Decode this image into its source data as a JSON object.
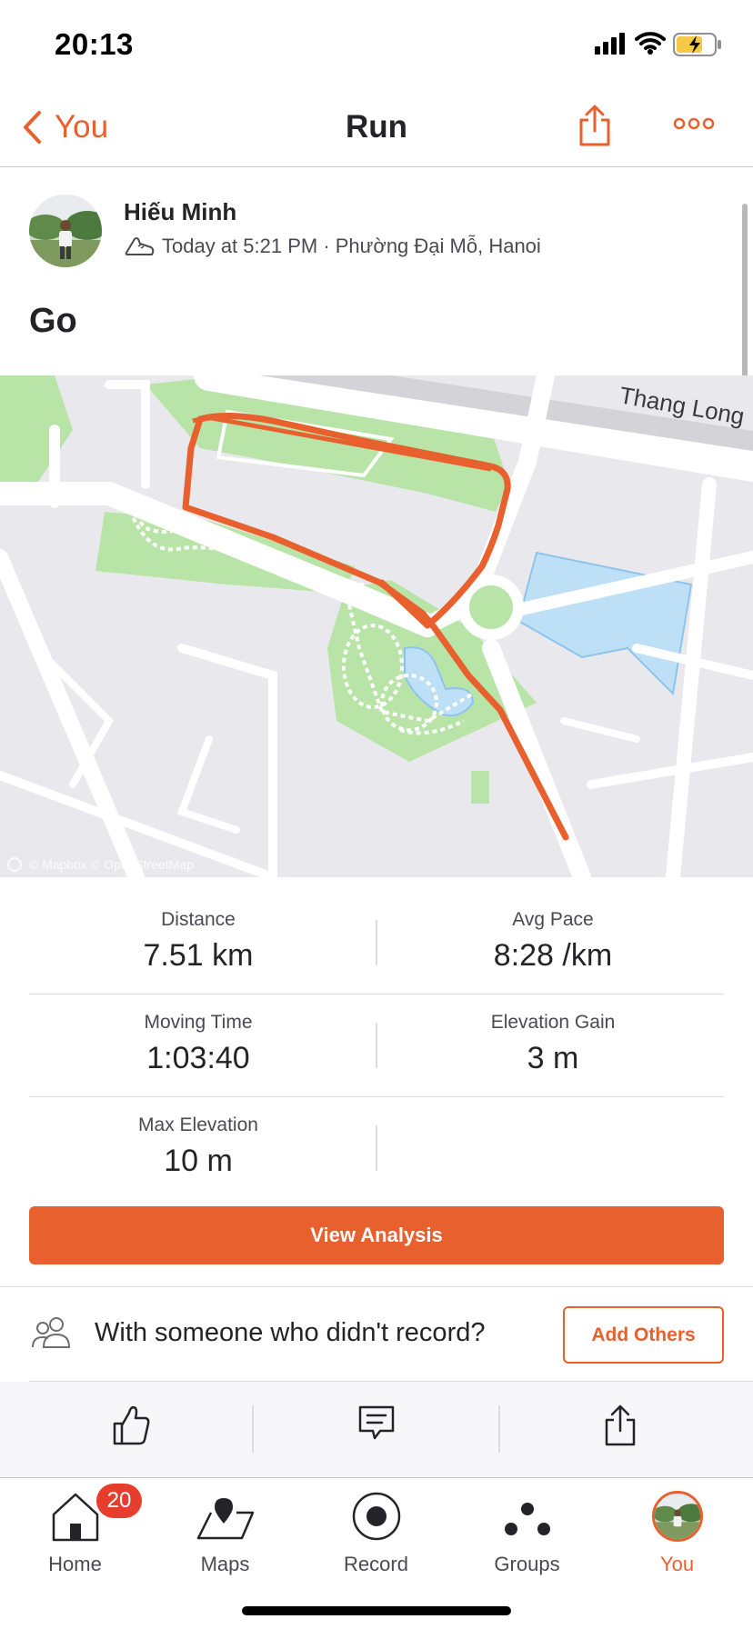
{
  "status_bar": {
    "time": "20:13"
  },
  "nav": {
    "back_label": "You",
    "title": "Run"
  },
  "activity": {
    "author": "Hiếu Minh",
    "meta": "Today at 5:21 PM · Phường Đại Mỗ, Hanoi",
    "title": "Go"
  },
  "map": {
    "street_label": "Thang Long",
    "attribution": "© Mapbox © OpenStreetMap",
    "route_color": "#e8602d"
  },
  "stats": {
    "distance": {
      "label": "Distance",
      "value": "7.51 km"
    },
    "avg_pace": {
      "label": "Avg Pace",
      "value": "8:28 /km"
    },
    "moving_time": {
      "label": "Moving Time",
      "value": "1:03:40"
    },
    "elevation_gain": {
      "label": "Elevation Gain",
      "value": "3 m"
    },
    "max_elevation": {
      "label": "Max Elevation",
      "value": "10 m"
    }
  },
  "view_analysis_label": "View Analysis",
  "others": {
    "prompt": "With someone who didn't record?",
    "button": "Add Others"
  },
  "actions": [
    "thumbs-up-icon",
    "comment-icon",
    "share-icon"
  ],
  "tabbar": {
    "home": {
      "label": "Home",
      "badge": "20"
    },
    "maps": {
      "label": "Maps"
    },
    "record": {
      "label": "Record"
    },
    "groups": {
      "label": "Groups"
    },
    "you": {
      "label": "You"
    }
  },
  "colors": {
    "accent": "#e8602d",
    "badge": "#e63d2f",
    "park": "#b9e4a8",
    "water": "#bde0f7"
  }
}
